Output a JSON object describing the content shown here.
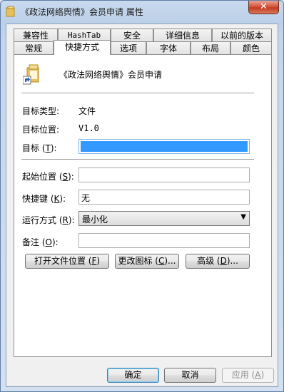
{
  "window": {
    "title": "《政法网络舆情》会员申请 属性",
    "close_label": "✕"
  },
  "tabs_back": [
    {
      "label": "兼容性"
    },
    {
      "label": "HashTab"
    },
    {
      "label": "安全"
    },
    {
      "label": "详细信息"
    },
    {
      "label": "以前的版本"
    }
  ],
  "tabs_front": [
    {
      "label": "常规"
    },
    {
      "label": "快捷方式"
    },
    {
      "label": "选项"
    },
    {
      "label": "字体"
    },
    {
      "label": "布局"
    },
    {
      "label": "颜色"
    }
  ],
  "shortcut": {
    "name": "《政法网络舆情》会员申请",
    "target_type_label": "目标类型:",
    "target_type_value": "文件",
    "target_location_label": "目标位置:",
    "target_location_value": "V1.0",
    "target_label_pre": "目标 (",
    "target_label_key": "T",
    "target_label_post": "):",
    "target_value": "",
    "start_in_label_pre": "起始位置 (",
    "start_in_label_key": "S",
    "start_in_label_post": "):",
    "start_in_value": "",
    "hotkey_label_pre": "快捷键 (",
    "hotkey_label_key": "K",
    "hotkey_label_post": "):",
    "hotkey_value": "无",
    "run_label_pre": "运行方式 (",
    "run_label_key": "R",
    "run_label_post": "):",
    "run_value": "最小化",
    "comment_label_pre": "备注 (",
    "comment_label_key": "O",
    "comment_label_post": "):",
    "comment_value": ""
  },
  "actions": {
    "open_location_pre": "打开文件位置 (",
    "open_location_key": "F",
    "open_location_post": ")",
    "change_icon_pre": "更改图标 (",
    "change_icon_key": "C",
    "change_icon_post": ")...",
    "advanced_pre": "高级 (",
    "advanced_key": "D",
    "advanced_post": ")..."
  },
  "footer": {
    "ok_label": "确定",
    "cancel_label": "取消",
    "apply_pre": "应用 (",
    "apply_key": "A",
    "apply_post": ")"
  },
  "colors": {
    "selection": "#3399ff",
    "close_button": "#c43b22"
  }
}
